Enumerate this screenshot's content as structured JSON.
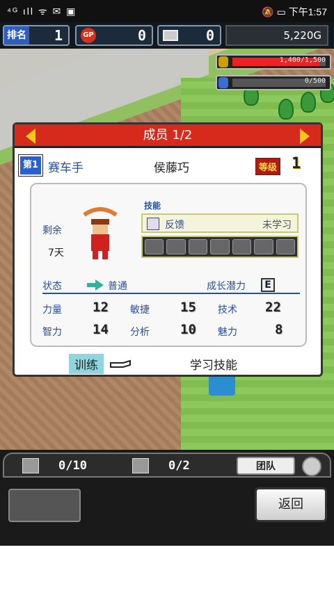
{
  "status_bar": {
    "left": "⁴ᴳ ıll  ᯤ ✉ ▣",
    "right": "🔕 ▭ 下午1:57"
  },
  "hud": {
    "rank_label": "排名",
    "rank_value": "1",
    "gp_label": "GP",
    "gp_value": "0",
    "pc_value": "0",
    "money": "5,220G"
  },
  "bars": [
    {
      "text": "1,400/1,500",
      "fraction": 0.93,
      "icon_color": "#c9a000"
    },
    {
      "text": "0/500",
      "fraction": 0,
      "icon_color": "#3a6fd0"
    }
  ],
  "panel": {
    "title": "成员 1/2",
    "rank_badge": "第1",
    "role": "赛车手",
    "name": "侯藤巧",
    "level_tag": "等级",
    "level": "1",
    "remain_label": "剩余",
    "remain_days": "7天",
    "skills_label": "技能",
    "skill_name": "反馈",
    "skill_status": "未学习",
    "status_label": "状态",
    "status_value": "普通",
    "growth_label": "成长潜力",
    "growth_value": "E",
    "stats": [
      {
        "label": "力量",
        "value": "12"
      },
      {
        "label": "敏捷",
        "value": "15"
      },
      {
        "label": "技术",
        "value": "22"
      },
      {
        "label": "智力",
        "value": "14"
      },
      {
        "label": "分析",
        "value": "10"
      },
      {
        "label": "魅力",
        "value": "8"
      }
    ],
    "train_label": "训练",
    "learn_label": "学习技能"
  },
  "bottom": {
    "tab1": "0/10",
    "tab2": "0/2",
    "team_label": "团队",
    "back_label": "返回"
  }
}
